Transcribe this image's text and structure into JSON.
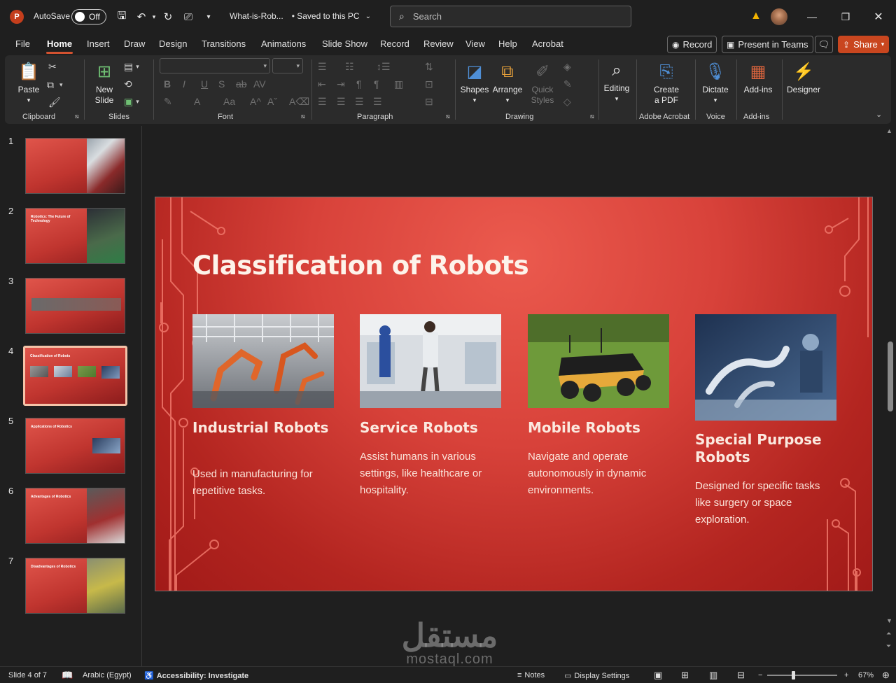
{
  "app": {
    "icon_letter": "P",
    "autosave_label": "AutoSave",
    "autosave_state": "Off",
    "doc_title": "What-is-Rob...",
    "save_status": "• Saved to this PC",
    "search_placeholder": "Search"
  },
  "tabs": [
    "File",
    "Home",
    "Insert",
    "Draw",
    "Design",
    "Transitions",
    "Animations",
    "Slide Show",
    "Record",
    "Review",
    "View",
    "Help",
    "Acrobat"
  ],
  "header_buttons": {
    "record": "Record",
    "present_teams": "Present in Teams",
    "share": "Share"
  },
  "ribbon": {
    "groups": {
      "clipboard": "Clipboard",
      "slides": "Slides",
      "font": "Font",
      "paragraph": "Paragraph",
      "drawing": "Drawing",
      "adobe": "Adobe Acrobat",
      "voice": "Voice",
      "addins": "Add-ins"
    },
    "items": {
      "paste": "Paste",
      "new_slide_1": "New",
      "new_slide_2": "Slide",
      "shapes": "Shapes",
      "arrange": "Arrange",
      "quick_styles_1": "Quick",
      "quick_styles_2": "Styles",
      "editing": "Editing",
      "create_pdf_1": "Create",
      "create_pdf_2": "a PDF",
      "dictate": "Dictate",
      "addins": "Add-ins",
      "designer": "Designer"
    }
  },
  "thumbnails": [
    {
      "num": "1",
      "title": ""
    },
    {
      "num": "2",
      "title": "Robotics: The Future of Technology"
    },
    {
      "num": "3",
      "title": ""
    },
    {
      "num": "4",
      "title": "Classification of Robots"
    },
    {
      "num": "5",
      "title": "Applications of Robotics"
    },
    {
      "num": "6",
      "title": "Advantages of Robotics"
    },
    {
      "num": "7",
      "title": "Disadvantages of Robotics"
    }
  ],
  "slide": {
    "title": "Classification of Robots",
    "cards": [
      {
        "title": "Industrial Robots",
        "desc": "Used in manufacturing for repetitive tasks."
      },
      {
        "title": "Service Robots",
        "desc": "Assist humans in various settings, like healthcare or hospitality."
      },
      {
        "title": "Mobile Robots",
        "desc": "Navigate and operate autonomously in dynamic environments."
      },
      {
        "title": "Special Purpose Robots",
        "desc": "Designed for specific tasks like surgery or space exploration."
      }
    ]
  },
  "watermark": {
    "arabic": "مستقل",
    "latin": "mostaql.com"
  },
  "status": {
    "slide_of": "Slide 4 of 7",
    "language": "Arabic (Egypt)",
    "accessibility": "Accessibility: Investigate",
    "notes": "Notes",
    "display_settings": "Display Settings",
    "zoom": "67%"
  },
  "colors": {
    "accent": "#d35230",
    "slide_red": "#d8423a",
    "slide_text": "#fdf3ea"
  }
}
